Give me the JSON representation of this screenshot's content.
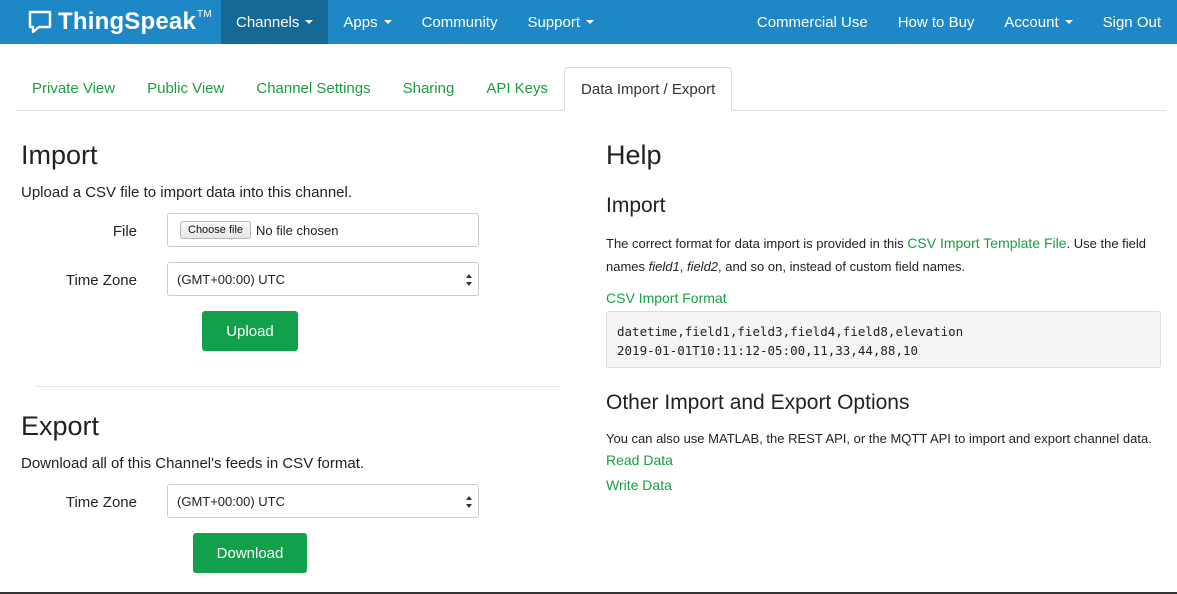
{
  "navbar": {
    "brand": "ThingSpeak",
    "brand_tm": "TM",
    "items": [
      {
        "label": "Channels",
        "dropdown": true,
        "active": true
      },
      {
        "label": "Apps",
        "dropdown": true
      },
      {
        "label": "Community",
        "dropdown": false
      },
      {
        "label": "Support",
        "dropdown": true
      }
    ],
    "right_items": [
      {
        "label": "Commercial Use"
      },
      {
        "label": "How to Buy"
      },
      {
        "label": "Account",
        "dropdown": true
      },
      {
        "label": "Sign Out"
      }
    ],
    "color": "#1e88c7",
    "active_color": "#156996"
  },
  "tabs": [
    {
      "label": "Private View"
    },
    {
      "label": "Public View"
    },
    {
      "label": "Channel Settings"
    },
    {
      "label": "Sharing"
    },
    {
      "label": "API Keys"
    },
    {
      "label": "Data Import / Export",
      "active": true
    }
  ],
  "import": {
    "title": "Import",
    "description": "Upload a CSV file to import data into this channel.",
    "file_label": "File",
    "file_button": "Choose file",
    "file_status": "No file chosen",
    "timezone_label": "Time Zone",
    "timezone_value": "(GMT+00:00) UTC",
    "upload_button": "Upload"
  },
  "export": {
    "title": "Export",
    "description": "Download all of this Channel's feeds in CSV format.",
    "timezone_label": "Time Zone",
    "timezone_value": "(GMT+00:00) UTC",
    "download_button": "Download"
  },
  "help": {
    "title": "Help",
    "import_title": "Import",
    "import_text_1": "The correct format for data import is provided in this ",
    "import_link": "CSV Import Template File",
    "import_text_2": ". Use the field names ",
    "field1": "field1",
    "comma": ", ",
    "field2": "field2",
    "import_text_3": ", and so on, instead of custom field names.",
    "format_link": "CSV Import Format",
    "code_line_1": "datetime,field1,field3,field4,field8,elevation",
    "code_line_2": "2019-01-01T10:11:12-05:00,11,33,44,88,10",
    "other_title": "Other Import and Export Options",
    "other_text": "You can also use MATLAB, the REST API, or the MQTT API to import and export channel data.",
    "read_link": "Read Data",
    "write_link": "Write Data"
  },
  "colors": {
    "link_green": "#1a9e3f",
    "button_green": "#12a14a"
  }
}
